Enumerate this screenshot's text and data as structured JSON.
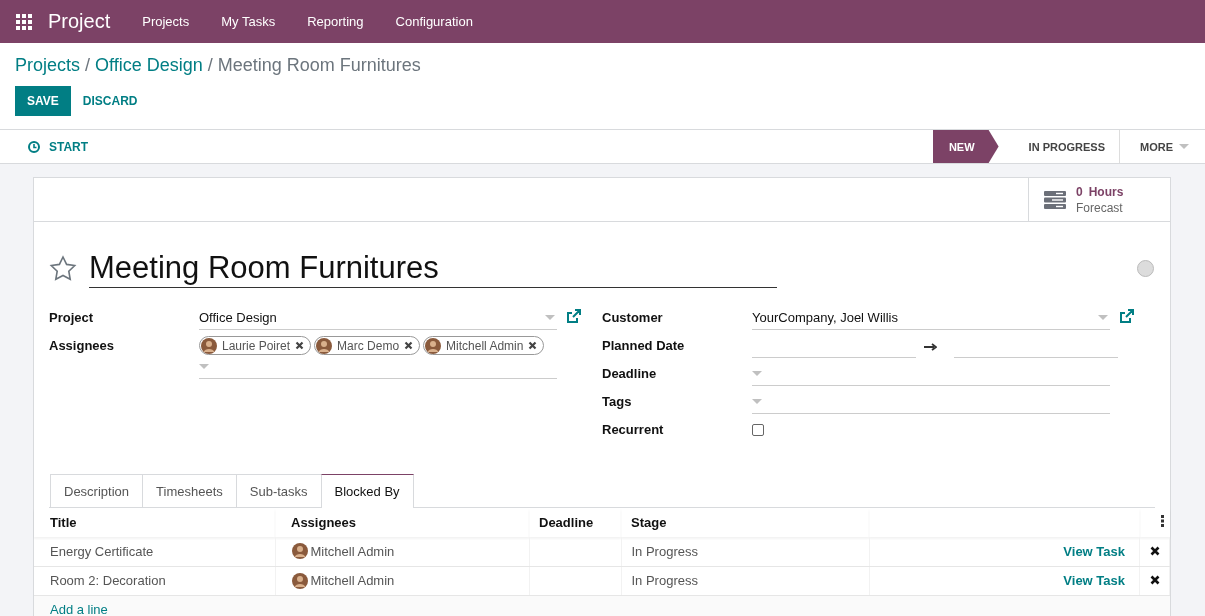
{
  "navbar": {
    "app": "Project",
    "menu": [
      "Projects",
      "My Tasks",
      "Reporting",
      "Configuration"
    ]
  },
  "breadcrumb_separator": "/",
  "breadcrumb": [
    {
      "label": "Projects",
      "kind": "link"
    },
    {
      "label": "Office Design",
      "kind": "link"
    },
    {
      "label": "Meeting Room Furnitures",
      "kind": "current"
    }
  ],
  "buttons": [
    {
      "label": "SAVE",
      "kind": "primary"
    },
    {
      "label": "DISCARD",
      "kind": "secondary"
    }
  ],
  "header_button": "START",
  "stages": [
    {
      "label": "NEW",
      "selected": true
    },
    {
      "label": "IN PROGRESS",
      "selected": false
    }
  ],
  "more": "MORE",
  "stat": {
    "value": "0",
    "unit": "Hours",
    "label": "Forecast"
  },
  "task": {
    "title": "Meeting Room Furnitures",
    "starred": false,
    "ready": false
  },
  "left_fields": [
    {
      "label": "Project",
      "kind": "many2one",
      "value": "Office Design",
      "external": true
    },
    {
      "label": "Assignees",
      "kind": "tags",
      "tags": [
        "Laurie Poiret",
        "Marc Demo",
        "Mitchell Admin"
      ]
    }
  ],
  "right_fields": [
    {
      "label": "Customer",
      "kind": "many2one",
      "value": "YourCompany, Joel Willis",
      "external": true
    },
    {
      "label": "Planned Date",
      "kind": "daterange"
    },
    {
      "label": "Deadline",
      "kind": "many2one"
    },
    {
      "label": "Tags",
      "kind": "many2one"
    },
    {
      "label": "Recurrent",
      "kind": "checkbox",
      "checked": false
    }
  ],
  "tabs": [
    {
      "label": "Description",
      "selected": false
    },
    {
      "label": "Timesheets",
      "selected": false
    },
    {
      "label": "Sub-tasks",
      "selected": false
    },
    {
      "label": "Blocked By",
      "selected": true
    }
  ],
  "table": {
    "columns": [
      "Title",
      "Assignees",
      "Deadline",
      "Stage"
    ],
    "rows": [
      {
        "title": "Energy Certificate",
        "assignee": "Mitchell Admin",
        "stage": "In Progress",
        "action": "View Task"
      },
      {
        "title": "Room 2: Decoration",
        "assignee": "Mitchell Admin",
        "stage": "In Progress",
        "action": "View Task"
      }
    ],
    "add_line": "Add a line"
  }
}
